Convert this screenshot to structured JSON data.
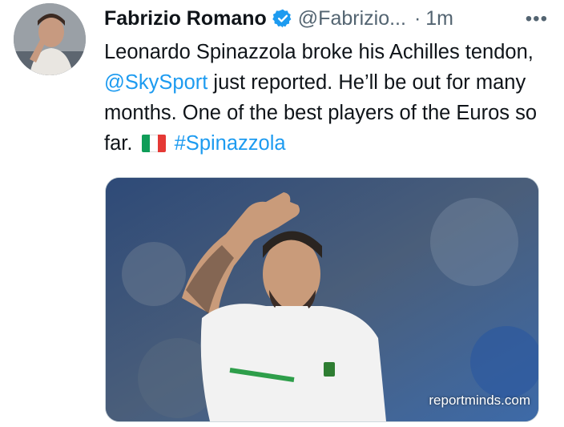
{
  "author": {
    "name": "Fabrizio Romano",
    "handle": "@Fabrizio...",
    "separator": "·",
    "time": "1m",
    "verified_color": "#1d9bf0"
  },
  "menu": {
    "more_label": "•••"
  },
  "tweet": {
    "text_1": "Leonardo Spinazzola broke his Achilles tendon, ",
    "mention": "@SkySport",
    "text_2": " just reported. He’ll be out for many months. One of the best players of the Euros so far. ",
    "flag": "italy-flag-emoji",
    "hashtag": "#Spinazzola",
    "link_color": "#1d9bf0"
  },
  "media": {
    "subject": "footballer-waving-photo",
    "watermark": "reportminds.com"
  },
  "icons": {
    "more": "more-horizontal-icon",
    "verified": "verified-badge-icon"
  }
}
